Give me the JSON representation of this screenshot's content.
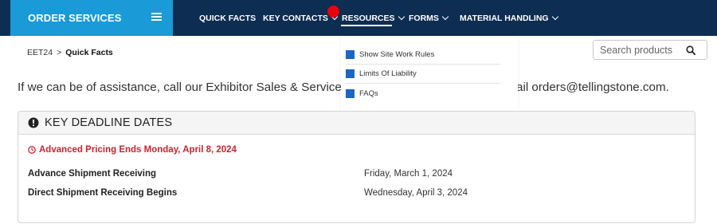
{
  "brand": {
    "label": "ORDER SERVICES"
  },
  "nav": {
    "items": [
      {
        "label": "QUICK FACTS",
        "has_dropdown": false
      },
      {
        "label": "KEY CONTACTS",
        "has_dropdown": true
      },
      {
        "label": "RESOURCES",
        "has_dropdown": true,
        "active": true
      },
      {
        "label": "FORMS",
        "has_dropdown": true
      },
      {
        "label": "MATERIAL HANDLING",
        "has_dropdown": true
      }
    ]
  },
  "dropdown": {
    "items": [
      {
        "label": "Show Site Work Rules"
      },
      {
        "label": "Limits Of Liability"
      },
      {
        "label": "FAQs"
      }
    ]
  },
  "breadcrumb": {
    "parent": "EET24",
    "separator": ">",
    "current": "Quick Facts"
  },
  "search": {
    "placeholder": "Search products",
    "value": ""
  },
  "intro": {
    "left_text": "If we can be of assistance, call our Exhibitor Sales & Service De",
    "right_text": "ail orders@tellingstone.com."
  },
  "deadlines": {
    "title": "KEY DEADLINE DATES",
    "alert": "Advanced Pricing Ends Monday, April 8, 2024",
    "rows": [
      {
        "label": "Advance Shipment Receiving",
        "value": "Friday, March 1, 2024"
      },
      {
        "label": "Direct Shipment Receiving Begins",
        "value": "Wednesday, April 3, 2024"
      }
    ]
  },
  "colors": {
    "nav_bg": "#0d2d52",
    "brand_bg": "#1a9ad6",
    "alert_red": "#d0222e",
    "menu_square": "#1a66c5",
    "cursor_dot": "#e8000b"
  }
}
